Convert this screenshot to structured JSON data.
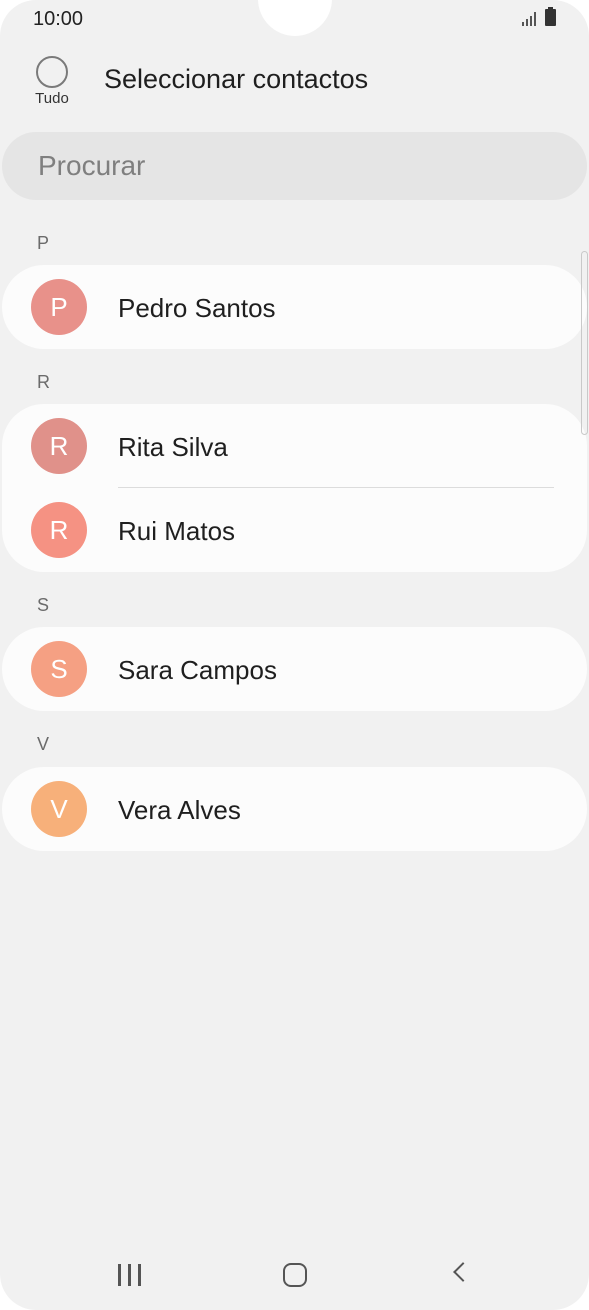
{
  "status_bar": {
    "time": "10:00"
  },
  "header": {
    "select_all_label": "Tudo",
    "title": "Seleccionar contactos"
  },
  "search": {
    "placeholder": "Procurar"
  },
  "sections": [
    {
      "letter": "P",
      "contacts": [
        {
          "initial": "P",
          "name": "Pedro Santos",
          "color": "#e8918a"
        }
      ]
    },
    {
      "letter": "R",
      "contacts": [
        {
          "initial": "R",
          "name": "Rita Silva",
          "color": "#e0918a"
        },
        {
          "initial": "R",
          "name": "Rui Matos",
          "color": "#f59283"
        }
      ]
    },
    {
      "letter": "S",
      "contacts": [
        {
          "initial": "S",
          "name": "Sara Campos",
          "color": "#f5a083"
        }
      ]
    },
    {
      "letter": "V",
      "contacts": [
        {
          "initial": "V",
          "name": "Vera Alves",
          "color": "#f7b07a"
        }
      ]
    }
  ],
  "icons": {
    "select_all": "circle-checkbox-icon",
    "signal": "signal-icon",
    "battery": "battery-icon",
    "nav_recent": "recent-apps-icon",
    "nav_home": "home-icon",
    "nav_back": "back-icon"
  }
}
